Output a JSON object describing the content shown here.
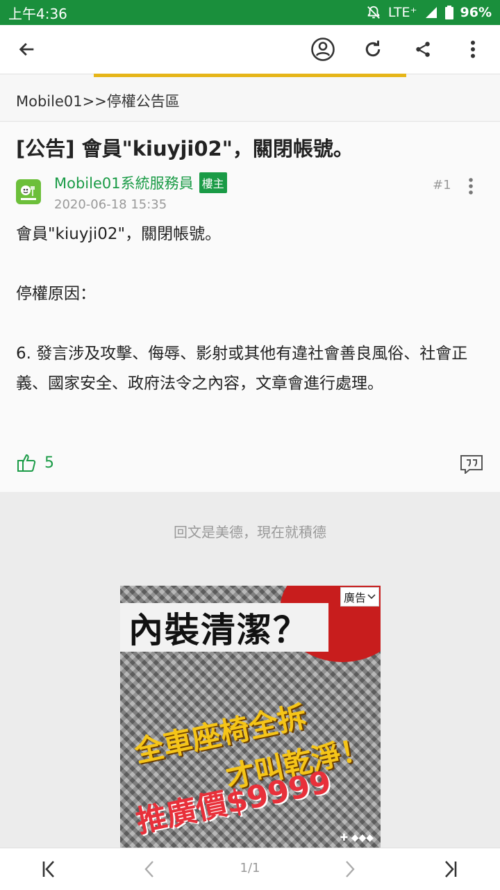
{
  "status_bar": {
    "time": "上午4:36",
    "network": "LTE⁺",
    "battery": "96%"
  },
  "breadcrumb": {
    "text": "Mobile01>>停權公告區"
  },
  "post": {
    "title": "[公告] 會員\"kiuyji02\"，關閉帳號。",
    "author": "Mobile01系統服務員",
    "badge": "樓主",
    "time": "2020-06-18 15:35",
    "floor": "#1",
    "body": "會員\"kiuyji02\"，關閉帳號。\n\n停權原因：\n\n6. 發言涉及攻擊、侮辱、影射或其他有違社會善良風俗、社會正義、國家安全、政府法令之內容，文章會進行處理。",
    "likes": "5"
  },
  "encourage_text": "回文是美德，現在就積德",
  "ad": {
    "label": "廣告",
    "headline": "內裝清潔？",
    "line2": "全車座椅全拆",
    "line3": "才叫乾淨！",
    "line4": "推廣價$9999"
  },
  "pager": {
    "page": "1/1"
  },
  "colors": {
    "status_bar": "#1a8f3c",
    "accent_green": "#1a9b46",
    "progress_yellow": "#e6b518"
  }
}
